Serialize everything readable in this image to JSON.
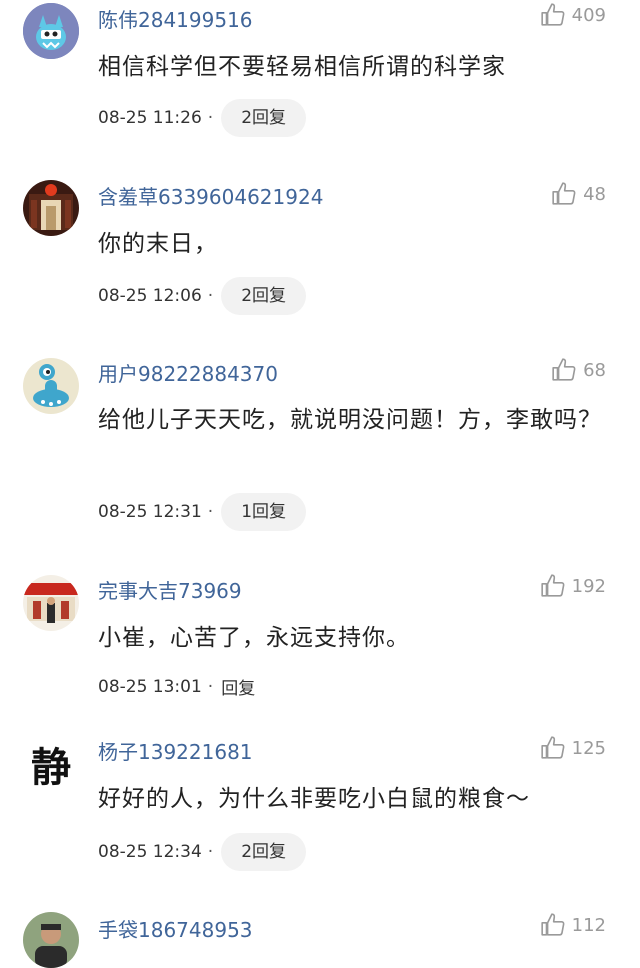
{
  "comments": [
    {
      "user": "陈伟284199516",
      "likes": "409",
      "text": "相信科学但不要轻易相信所谓的科学家",
      "time": "08-25 11:26",
      "reply": "2回复",
      "avatar": "blue-monster"
    },
    {
      "user": "含羞草6339604621924",
      "likes": "48",
      "text": "你的末日，",
      "time": "08-25 12:06",
      "reply": "2回复",
      "avatar": "red-lantern-corridor"
    },
    {
      "user": "用户98222884370",
      "likes": "68",
      "text": "给他儿子天天吃，就说明没问题！方，李敢吗？",
      "time": "08-25 12:31",
      "reply": "1回复",
      "avatar": "blue-alien"
    },
    {
      "user": "完事大吉73969",
      "likes": "192",
      "text": "小崔，心苦了，永远支持你。",
      "time": "08-25 13:01",
      "reply": "回复",
      "avatar": "photo-red-building"
    },
    {
      "user": "杨子139221681",
      "likes": "125",
      "text": "好好的人，为什么非要吃小白鼠的粮食～",
      "time": "08-25 12:34",
      "reply": "2回复",
      "avatar": "calligraphy-jing"
    },
    {
      "user": "手袋186748953",
      "likes": "112",
      "avatar": "photo-person"
    }
  ],
  "calligraphy_char": "静",
  "meta_separator": "·",
  "colors": {
    "username": "#406599",
    "muted": "#9a9a9a",
    "pill_bg": "#f2f2f2"
  }
}
